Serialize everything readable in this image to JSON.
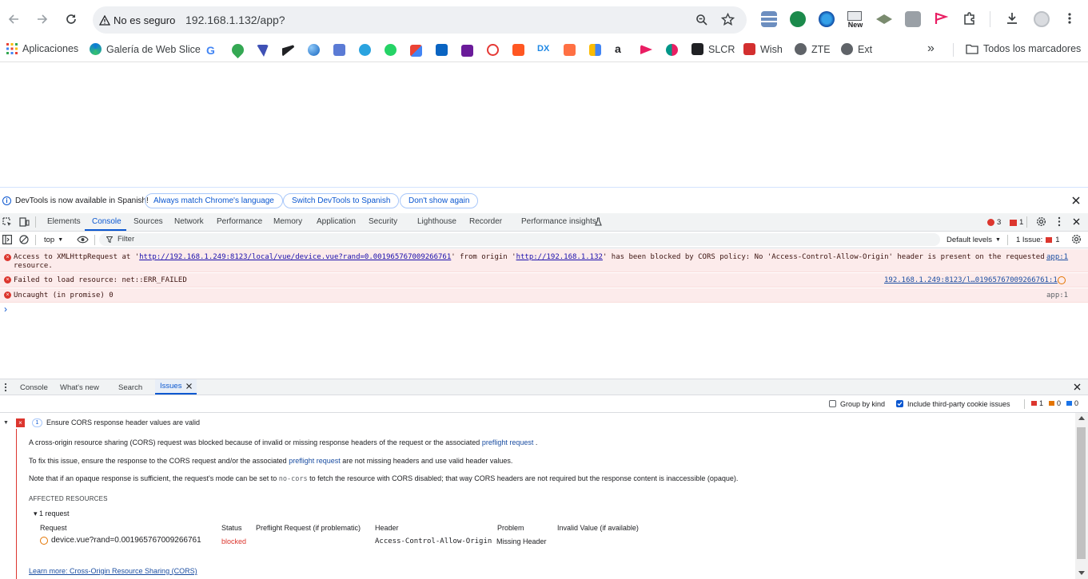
{
  "toolbar": {
    "security_chip": "No es seguro",
    "url": "192.168.1.132/app?",
    "new_badge": "New"
  },
  "bookmarks": {
    "apps": "Aplicaciones",
    "web_slice": "Galería de Web Slice",
    "slcr": "SLCR",
    "wish": "Wish",
    "zte": "ZTE",
    "ext": "Ext",
    "all": "Todos los marcadores",
    "overflow": "»"
  },
  "infobar": {
    "message": "DevTools is now available in Spanish!",
    "btn_match": "Always match Chrome's language",
    "btn_switch": "Switch DevTools to Spanish",
    "btn_dismiss": "Don't show again"
  },
  "devtools_tabs": [
    "Elements",
    "Console",
    "Sources",
    "Network",
    "Performance",
    "Memory",
    "Application",
    "Security",
    "Lighthouse",
    "Recorder",
    "Performance insights"
  ],
  "devtools_counts": {
    "errors": "3",
    "issues": "1"
  },
  "console_toolbar": {
    "context": "top",
    "filter_placeholder": "Filter",
    "levels": "Default levels",
    "issue_label": "1 Issue:",
    "issue_count": "1"
  },
  "messages": [
    {
      "pre": "Access to XMLHttpRequest at '",
      "url1": "http://192.168.1.249:8123/local/vue/device.vue?rand=0.001965767009266761",
      "mid": "' from origin '",
      "url2": "http://192.168.1.132",
      "post": "' has been blocked by CORS policy: No 'Access-Control-Allow-Origin' header is present on the requested",
      "line2": "resource.",
      "source": "app:1"
    },
    {
      "text": "Failed to load resource: net::ERR_FAILED",
      "source": "192.168.1.249:8123/l…019657670092667​61:1"
    },
    {
      "text": "Uncaught (in promise) 0",
      "source": "app:1"
    }
  ],
  "prompt": "›",
  "drawer_tabs": [
    "Console",
    "What's new",
    "Search",
    "Issues"
  ],
  "issues_bar": {
    "group_by_kind": "Group by kind",
    "third_party": "Include third-party cookie issues",
    "count_red": "1",
    "count_orange": "0",
    "count_blue": "0"
  },
  "issue": {
    "count": "1",
    "title": "Ensure CORS response header values are valid",
    "p1_pre": "A cross-origin resource sharing (CORS) request was blocked because of invalid or missing response headers of the request or the associated",
    "p1_link": "preflight request",
    "p1_post": ".",
    "p2_pre": "To fix this issue, ensure the response to the CORS request and/or the associated",
    "p2_link": "preflight request",
    "p2_post": "are not missing headers and use valid header values.",
    "p3_pre": "Note that if an opaque response is sufficient, the request's mode can be set to",
    "p3_code": "no-cors",
    "p3_post": "to fetch the resource with CORS disabled; that way CORS headers are not required but the response content is inaccessible (opaque).",
    "affected": "AFFECTED RESOURCES",
    "requests_toggle": "▾ 1 request",
    "columns": [
      "Request",
      "Status",
      "Preflight Request (if problematic)",
      "Header",
      "Problem",
      "Invalid Value (if available)"
    ],
    "row": {
      "request": "device.vue?rand=0.001965767009266761",
      "status": "blocked",
      "header": "Access-Control-Allow-Origin",
      "problem": "Missing Header"
    },
    "learn_more": "Learn more: Cross-Origin Resource Sharing (CORS)"
  },
  "colors": {
    "accent": "#0b57d0",
    "error": "#dc362e",
    "error_bg": "#fcebeb"
  }
}
